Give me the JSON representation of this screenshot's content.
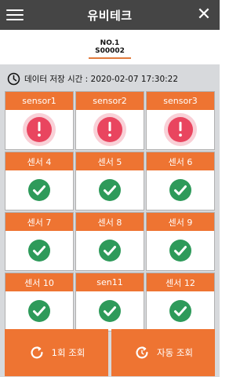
{
  "header": {
    "title": "유비테크",
    "close_glyph": "✕"
  },
  "tab": {
    "line1": "NO.1",
    "line2": "S00002"
  },
  "timestamp": {
    "label": "데이터 저장 시간 : 2020-02-07 17:30:22",
    "icon": "clock-icon"
  },
  "colors": {
    "accent": "#ee7432",
    "alert": "#e9455f",
    "ok": "#2e9a5a",
    "header_bg": "#454545"
  },
  "sensors": [
    {
      "name": "sensor1",
      "status": "alert"
    },
    {
      "name": "sensor2",
      "status": "alert"
    },
    {
      "name": "sensor3",
      "status": "alert"
    },
    {
      "name": "센서 4",
      "status": "ok"
    },
    {
      "name": "센서 5",
      "status": "ok"
    },
    {
      "name": "센서 6",
      "status": "ok"
    },
    {
      "name": "센서 7",
      "status": "ok"
    },
    {
      "name": "센서 8",
      "status": "ok"
    },
    {
      "name": "센서 9",
      "status": "ok"
    },
    {
      "name": "센서 10",
      "status": "ok"
    },
    {
      "name": "sen11",
      "status": "ok"
    },
    {
      "name": "센서 12",
      "status": "ok"
    }
  ],
  "buttons": {
    "once": "1회 조회",
    "auto": "자동 조회"
  }
}
